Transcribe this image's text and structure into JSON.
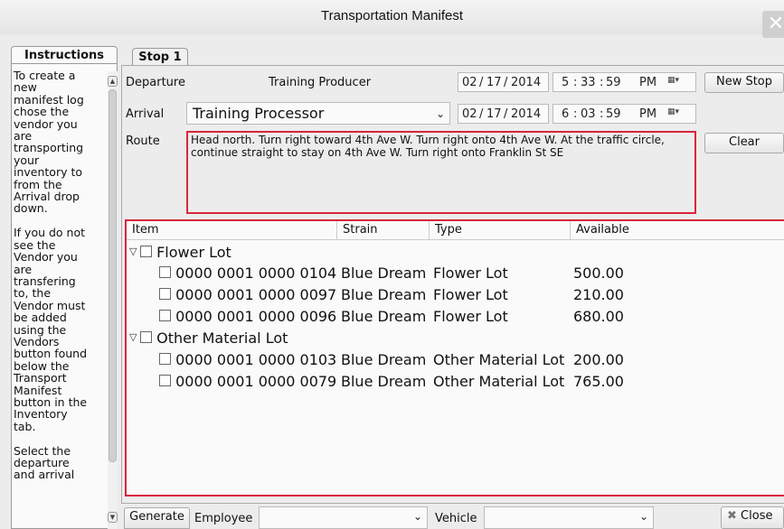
{
  "window": {
    "title": "Transportation Manifest",
    "close_label": "✕"
  },
  "instructions": {
    "tab_label": "Instructions",
    "text": "To create a new\nmanifest log\nchose the\nvendor you\nare\ntransporting\nyour\ninventory to\nfrom the\nArrival drop\ndown.\n\nIf you do not\nsee the\nVendor you\nare\ntransfering\nto, the\nVendor must\nbe added\nusing the\nVendors\nbutton found\nbelow the\nTransport\nManifest\nbutton in the\nInventory\ntab.\n\nSelect the\ndeparture\nand arrival"
  },
  "stop": {
    "tab_label": "Stop 1",
    "departure": {
      "label": "Departure",
      "value": "Training Producer",
      "date": {
        "month": "02",
        "day": "17",
        "year": "2014",
        "hour": "5",
        "minute": "33",
        "second": "59",
        "ampm": "PM"
      }
    },
    "arrival": {
      "label": "Arrival",
      "value": "Training Processor",
      "date": {
        "month": "02",
        "day": "17",
        "year": "2014",
        "hour": "6",
        "minute": "03",
        "second": "59",
        "ampm": "PM"
      }
    },
    "route": {
      "label": "Route",
      "text": "Head north. Turn right toward 4th Ave W. Turn right onto 4th Ave W. At the traffic circle, continue straight to stay on 4th Ave W. Turn right onto Franklin St SE"
    },
    "buttons": {
      "new_stop": "New Stop",
      "clear": "Clear"
    }
  },
  "items_table": {
    "headers": [
      "Item",
      "Strain",
      "Type",
      "Available"
    ],
    "groups": [
      {
        "name": "Flower Lot",
        "rows": [
          {
            "id": "0000 0001 0000 0104",
            "strain": "Blue Dream",
            "type": "Flower Lot",
            "available": "500.00"
          },
          {
            "id": "0000 0001 0000 0097",
            "strain": "Blue Dream",
            "type": "Flower Lot",
            "available": "210.00"
          },
          {
            "id": "0000 0001 0000 0096",
            "strain": "Blue Dream",
            "type": "Flower Lot",
            "available": "680.00"
          }
        ]
      },
      {
        "name": "Other Material Lot",
        "rows": [
          {
            "id": "0000 0001 0000 0103",
            "strain": "Blue Dream",
            "type": "Other Material Lot",
            "available": "200.00"
          },
          {
            "id": "0000 0001 0000 0079",
            "strain": "Blue Dream",
            "type": "Other Material Lot",
            "available": "765.00"
          }
        ]
      }
    ]
  },
  "bottom": {
    "generate": "Generate",
    "employee_label": "Employee",
    "employee_value": "",
    "vehicle_label": "Vehicle",
    "vehicle_value": "",
    "close": "Close"
  },
  "colors": {
    "highlight_border": "#d9253b"
  },
  "icons": {
    "calendar": "calendar-icon",
    "close": "close-icon"
  }
}
